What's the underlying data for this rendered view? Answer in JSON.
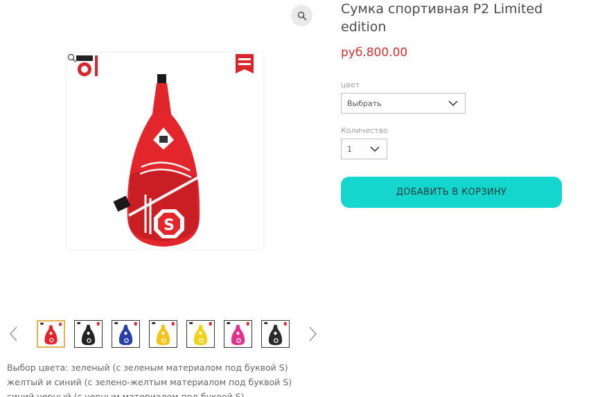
{
  "product": {
    "title": "Сумка спортивная P2 Limited edition",
    "price": "руб.800.00",
    "color_label": "цвет",
    "color_select_value": "Выбрать",
    "quantity_label": "Количество",
    "quantity_value": "1",
    "add_to_cart_label": "ДОБАВИТЬ В КОРЗИНУ",
    "brand_colors": {
      "button": "#15d6cd",
      "price": "#d32f2f",
      "active_thumb": "#e2b54c"
    }
  },
  "thumbnails": [
    {
      "name": "red",
      "color": "#e0262b",
      "active": true
    },
    {
      "name": "black",
      "color": "#222222",
      "active": false
    },
    {
      "name": "blue",
      "color": "#2a3ea8",
      "active": false
    },
    {
      "name": "yellow-blue",
      "color": "#f0c419",
      "active": false
    },
    {
      "name": "green-yellow",
      "color": "#f2d21b",
      "active": false
    },
    {
      "name": "pink",
      "color": "#e0338d",
      "active": false
    },
    {
      "name": "black-gray",
      "color": "#2b2b2b",
      "active": false
    }
  ],
  "description": {
    "lines": [
      "Выбор цвета: зеленый (с зеленым материалом под буквой S)",
      "желтый и синий (с зелено-желтым материалом под буквой S)",
      "синий черный (с черным материалом под буквой S)"
    ]
  },
  "icons": {
    "zoom": "magnifier-icon",
    "prev": "chevron-left-icon",
    "next": "chevron-right-icon",
    "dropdown": "chevron-down-icon"
  }
}
